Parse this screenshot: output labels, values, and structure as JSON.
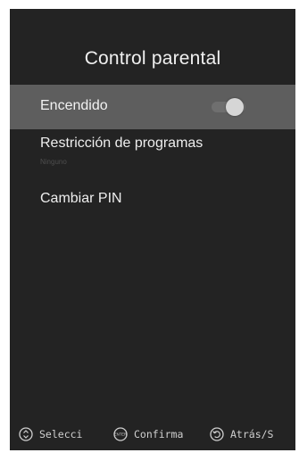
{
  "screen": {
    "title": "Control parental"
  },
  "menu": {
    "items": [
      {
        "label": "Encendido",
        "toggle_on": true,
        "selected": true
      },
      {
        "label": "Restricción de programas",
        "sublabel": "Ninguno"
      },
      {
        "label": "Cambiar PIN"
      }
    ]
  },
  "footer": {
    "select_label": "Selecci",
    "confirm_label": "Confirma",
    "back_label": "Atrás/S",
    "enter_icon_text": "ENTER"
  },
  "colors": {
    "panel_bg": "#232323",
    "highlight_bg": "#5e5e5e",
    "text": "#eeeeee"
  }
}
